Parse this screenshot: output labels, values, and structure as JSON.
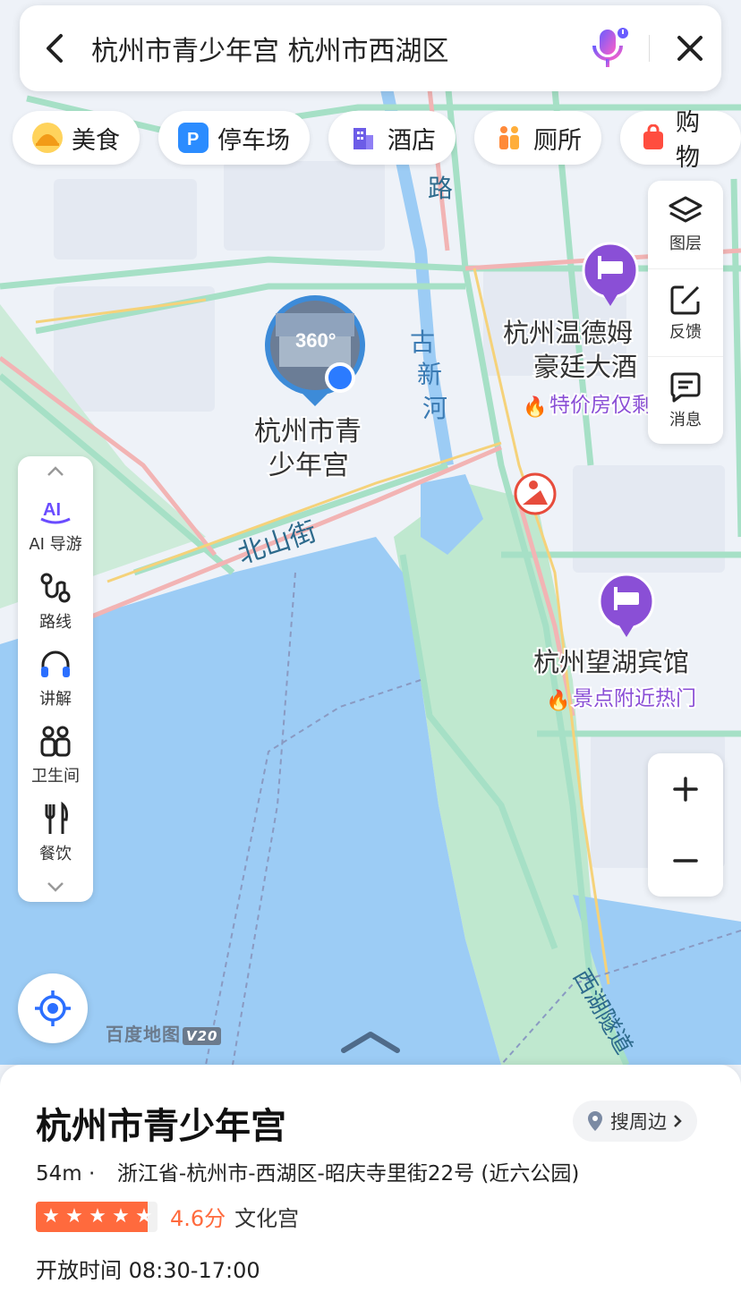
{
  "search": {
    "query": "杭州市青少年宫 杭州市西湖区"
  },
  "categories": [
    {
      "label": "美食",
      "icon": "food-icon",
      "color": "#f5a623"
    },
    {
      "label": "停车场",
      "icon": "parking-icon",
      "color": "#2b8cff"
    },
    {
      "label": "酒店",
      "icon": "hotel-icon",
      "color": "#6c5ce7"
    },
    {
      "label": "厕所",
      "icon": "toilet-icon",
      "color": "#ff7a30"
    },
    {
      "label": "购物",
      "icon": "shopping-icon",
      "color": "#ff4d3f"
    }
  ],
  "right_tools": {
    "layers": "图层",
    "feedback": "反馈",
    "messages": "消息"
  },
  "left_tools": {
    "ai_guide": "AI 导游",
    "route": "路线",
    "audio_guide": "讲解",
    "restroom": "卫生间",
    "dining": "餐饮"
  },
  "map": {
    "poi_name_line1": "杭州市青",
    "poi_name_line2": "少年宫",
    "pano_label": "360°",
    "hotel1_line1": "杭州温德姆",
    "hotel1_line2": "豪廷大酒",
    "hotel1_tag": "特价房仅剩",
    "hotel2_name": "杭州望湖宾馆",
    "hotel2_tag": "景点附近热门",
    "road_beishan": "北山街",
    "river_guxin": "古新河",
    "road_lu": "路",
    "tunnel": "西湖隧道",
    "watermark": "百度地图",
    "watermark_version": "V20"
  },
  "poi": {
    "title": "杭州市青少年宫",
    "nearby_label": "搜周边",
    "distance": "54m ·",
    "address": "浙江省-杭州市-西湖区-昭庆寺里街22号 (近六公园)",
    "rating": 4.6,
    "rating_text": "4.6分",
    "category": "文化宫",
    "hours": "开放时间 08:30-17:00"
  },
  "colors": {
    "water": "#9cccf5",
    "park": "#bfe8cf",
    "road_main": "#f2b0b0",
    "road_green": "#9fdcc1",
    "accent_purple": "#8a4fd6",
    "accent_orange": "#ff6a3d",
    "brand_blue": "#2b6fff"
  }
}
